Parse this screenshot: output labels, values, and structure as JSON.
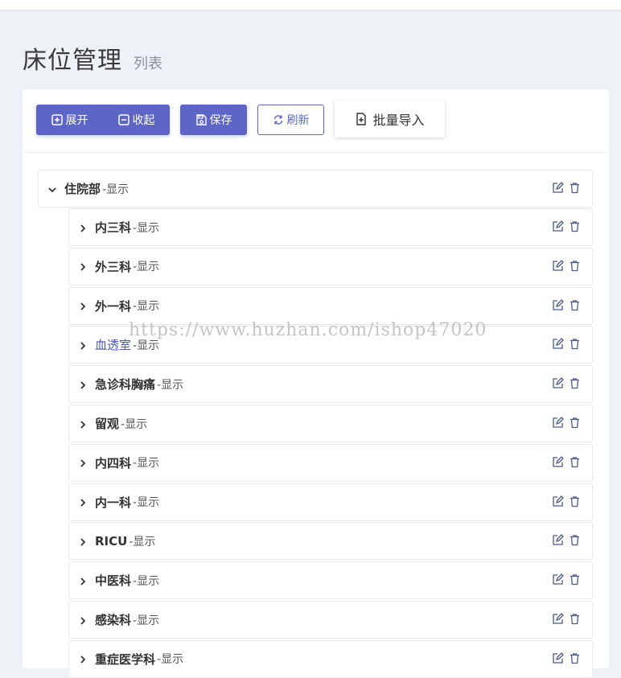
{
  "page": {
    "title": "床位管理",
    "subtitle": "列表"
  },
  "toolbar": {
    "expand_label": "展开",
    "collapse_label": "收起",
    "save_label": "保存",
    "refresh_label": "刷新",
    "import_label": "批量导入"
  },
  "tree": {
    "root": {
      "name": "住院部",
      "status": "-显示"
    },
    "children": [
      {
        "name": "内三科",
        "status": "-显示"
      },
      {
        "name": "外三科",
        "status": "-显示"
      },
      {
        "name": "外一科",
        "status": "-显示"
      },
      {
        "name": "血透室",
        "status": "-显示"
      },
      {
        "name": "急诊科胸痛",
        "status": "-显示"
      },
      {
        "name": "留观",
        "status": "-显示"
      },
      {
        "name": "内四科",
        "status": "-显示"
      },
      {
        "name": "内一科",
        "status": "-显示"
      },
      {
        "name": "RICU",
        "status": "-显示"
      },
      {
        "name": "中医科",
        "status": "-显示"
      },
      {
        "name": "感染科",
        "status": "-显示"
      },
      {
        "name": "重症医学科",
        "status": "-显示"
      }
    ]
  },
  "watermark": "https://www.huzhan.com/ishop47020",
  "colors": {
    "primary": "#5d66c7",
    "background": "#eef1f6",
    "link": "#4a56b3"
  }
}
